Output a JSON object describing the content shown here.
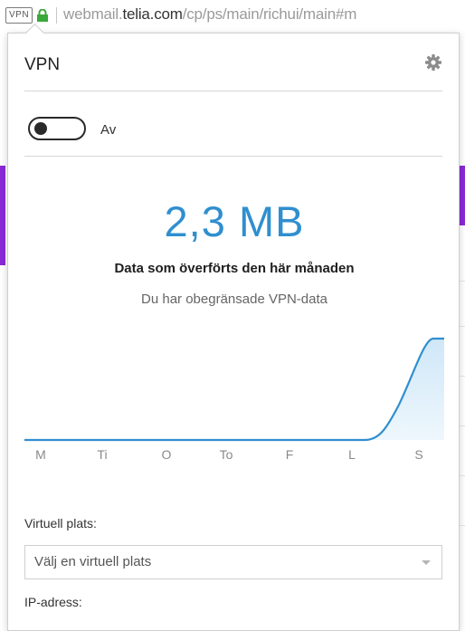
{
  "browser": {
    "vpn_badge": "VPN",
    "url_prefix": "webmail.",
    "url_host": "telia.com",
    "url_path": "/cp/ps/main/richui/main#m"
  },
  "popup": {
    "title": "VPN",
    "toggle": {
      "state_label": "Av",
      "on": false
    },
    "data_amount": "2,3 MB",
    "data_caption": "Data som överförts den här månaden",
    "data_note": "Du har obegränsade VPN-data",
    "chart_days": [
      "M",
      "Ti",
      "O",
      "To",
      "F",
      "L",
      "S"
    ],
    "virtual_location_label": "Virtuell plats:",
    "virtual_location_select": "Välj en virtuell plats",
    "ip_label": "IP-adress:"
  },
  "colors": {
    "accent": "#2f8fcf",
    "chart_fill": "#d6ecfa",
    "page_purple": "#8a2ad6"
  },
  "icons": {
    "settings": "gear-icon",
    "lock": "lock-icon",
    "select": "chevron-down-icon"
  }
}
